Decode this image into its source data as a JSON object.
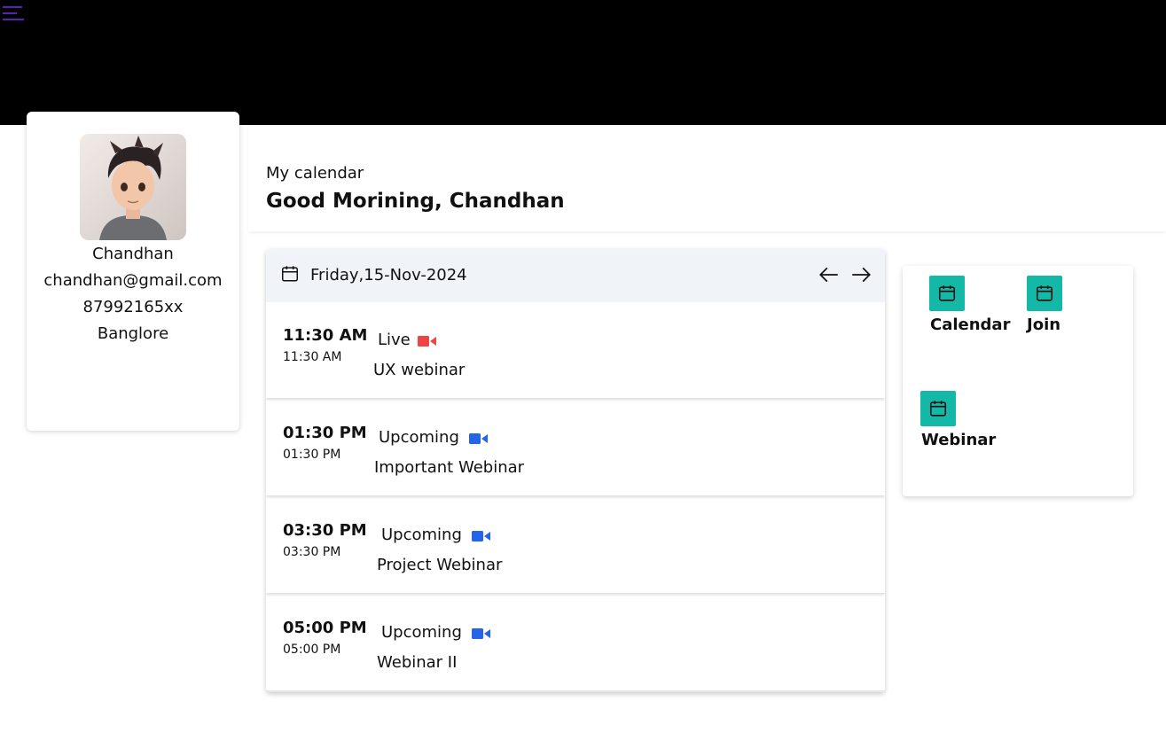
{
  "header": {
    "menu_icon": "hamburger-menu-icon",
    "menu_color": "#5b21b6",
    "background": "#000000"
  },
  "profile": {
    "name": "Chandhan",
    "email": "chandhan@gmail.com",
    "phone": "87992165xx",
    "location": "Banglore"
  },
  "greeting": {
    "subtitle": "My calendar",
    "title": "Good Morining, Chandhan"
  },
  "schedule": {
    "date_icon": "calendar-icon",
    "date": "Friday,15-Nov-2024",
    "prev_icon": "arrow-left-icon",
    "next_icon": "arrow-right-icon",
    "events": [
      {
        "time": "11:30 AM",
        "time_sub": "11:30 AM",
        "status": "Live",
        "status_color": "#ef4444",
        "title": "UX webinar"
      },
      {
        "time": "01:30 PM",
        "time_sub": "01:30 PM",
        "status": "Upcoming",
        "status_color": "#2563eb",
        "title": "Important Webinar"
      },
      {
        "time": "03:30 PM",
        "time_sub": "03:30 PM",
        "status": "Upcoming",
        "status_color": "#2563eb",
        "title": "Project Webinar"
      },
      {
        "time": "05:00 PM",
        "time_sub": "05:00 PM",
        "status": "Upcoming",
        "status_color": "#2563eb",
        "title": "Webinar II"
      }
    ]
  },
  "shortcuts": {
    "accent": "#14b8a6",
    "items": [
      {
        "label": "Calendar",
        "icon": "calendar-icon"
      },
      {
        "label": "Join",
        "icon": "calendar-icon"
      },
      {
        "label": "Webinar",
        "icon": "calendar-icon"
      }
    ]
  }
}
